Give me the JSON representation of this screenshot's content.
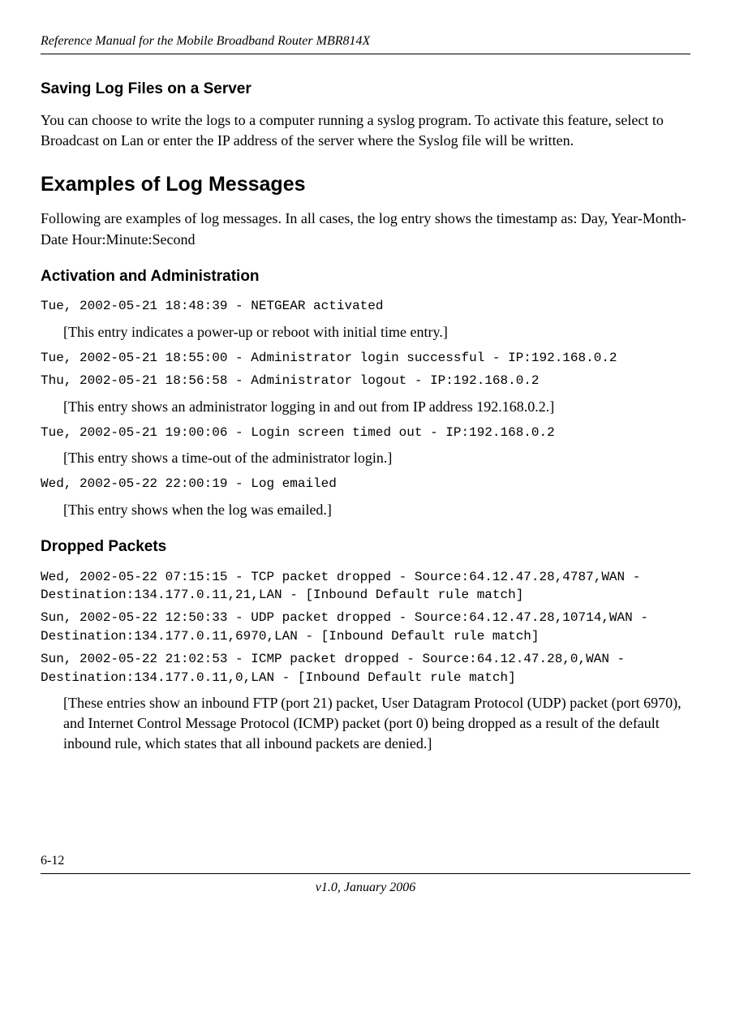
{
  "header": {
    "title": "Reference Manual for the Mobile Broadband Router MBR814X"
  },
  "section1": {
    "heading": "Saving Log Files on a Server",
    "para": "You can choose to write the logs to a computer running a syslog program. To activate this feature, select to Broadcast on Lan or enter the IP address of the server where the Syslog file will be written."
  },
  "section2": {
    "heading": "Examples of Log Messages",
    "para": "Following are examples of log messages. In all cases, the log entry shows the timestamp as:    Day, Year-Month-Date  Hour:Minute:Second"
  },
  "activation": {
    "heading": "Activation and Administration",
    "log1": "Tue, 2002-05-21 18:48:39 - NETGEAR activated",
    "note1": "[This entry indicates a power-up or reboot with initial time entry.]",
    "log2": "Tue, 2002-05-21 18:55:00 - Administrator login successful - IP:192.168.0.2",
    "log3": "Thu, 2002-05-21 18:56:58 - Administrator logout - IP:192.168.0.2",
    "note2": "[This entry shows an administrator logging in and out from IP address 192.168.0.2.]",
    "log4": "Tue, 2002-05-21 19:00:06 - Login screen timed out - IP:192.168.0.2",
    "note3": "[This entry shows a time-out of the administrator login.]",
    "log5": "Wed, 2002-05-22 22:00:19 - Log emailed",
    "note4": "[This entry shows when the log was emailed.]"
  },
  "dropped": {
    "heading": "Dropped Packets",
    "log1": "Wed, 2002-05-22 07:15:15 - TCP packet dropped - Source:64.12.47.28,4787,WAN - Destination:134.177.0.11,21,LAN - [Inbound Default rule match]",
    "log2": "Sun, 2002-05-22 12:50:33 - UDP packet dropped - Source:64.12.47.28,10714,WAN - Destination:134.177.0.11,6970,LAN - [Inbound Default rule match]",
    "log3": "Sun, 2002-05-22 21:02:53 - ICMP packet dropped - Source:64.12.47.28,0,WAN - Destination:134.177.0.11,0,LAN - [Inbound Default rule match]",
    "note1": "[These entries show an inbound FTP (port 21) packet, User Datagram Protocol (UDP) packet (port 6970), and Internet Control Message Protocol (ICMP) packet (port 0) being dropped as a result of the default inbound rule, which states that all inbound packets are denied.]"
  },
  "footer": {
    "pagenum": "6-12",
    "version": "v1.0, January 2006"
  }
}
